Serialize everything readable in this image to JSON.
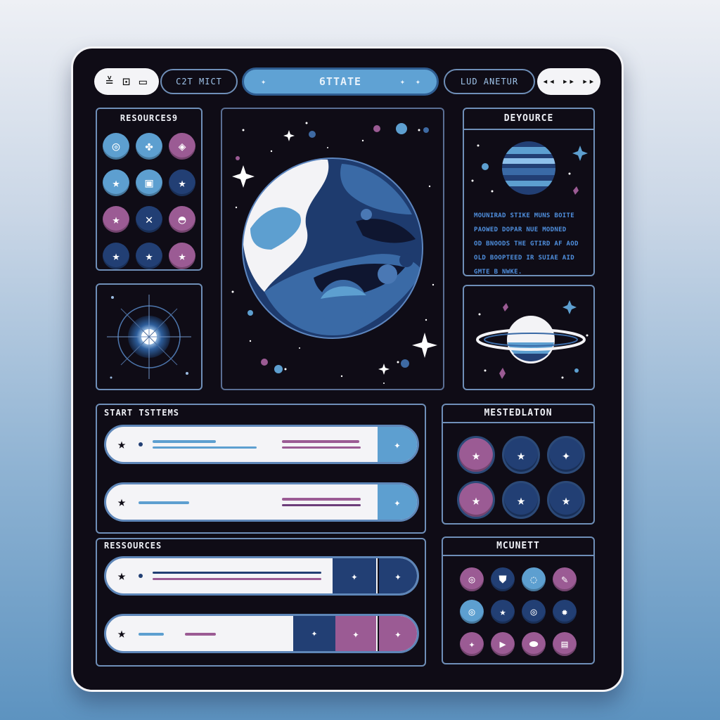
{
  "topbar": {
    "left_icons": [
      "≚",
      "⊡",
      "▭"
    ],
    "tab_left": "C2T  MICT",
    "title": "6TTATE",
    "tab_right": "LUD  ANETUR",
    "media_icons": "◂◂ ▸▸ ▸▸"
  },
  "resources_panel": {
    "title": "RESOURCES9"
  },
  "deyource_panel": {
    "title": "DEYOURCE",
    "lines": [
      "MOUNIRAD STIKE MUNS BOITE",
      "PAOWED DOPAR NUE MODNED",
      "OD BNOODS THE GTIRD AF AOD",
      "OLD BOOPTEED IR SUIAE AID",
      "GMTE B NWKE."
    ]
  },
  "start_panel": {
    "title": "START  TSTTEMS"
  },
  "ressources_panel": {
    "title": "RESSOURCES"
  },
  "mested_panel": {
    "title": "MESTEDLATON"
  },
  "mcunett_panel": {
    "title": "MCUNETT"
  },
  "colors": {
    "blue": "#5d9fd0",
    "navy": "#223f74",
    "purple": "#9b5b94",
    "frame": "#6f8fb8"
  }
}
